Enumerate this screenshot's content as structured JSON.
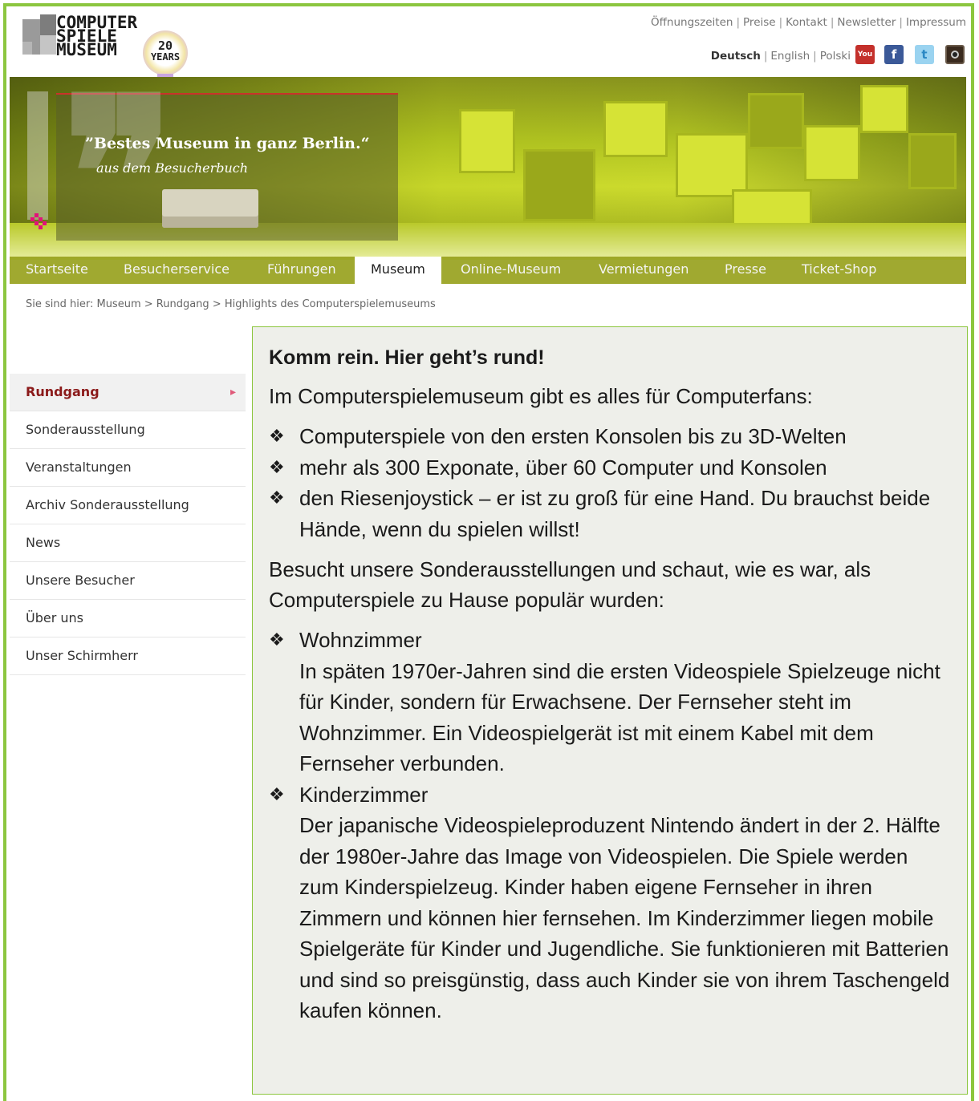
{
  "logo": {
    "line1": "COMPUTER",
    "line2": "SPIELE",
    "line3": "MUSEUM",
    "badge_number": "20",
    "badge_text": "YEARS"
  },
  "toplinks": [
    "Öffnungszeiten",
    "Preise",
    "Kontakt",
    "Newsletter",
    "Impressum"
  ],
  "languages": {
    "active": "Deutsch",
    "others": [
      "English",
      "Polski"
    ]
  },
  "social": {
    "youtube_label": "You",
    "facebook_label": "f",
    "twitter_label": "t"
  },
  "hero": {
    "quote": "”Bestes Museum in ganz Berlin.“",
    "source": "aus dem Besucherbuch"
  },
  "nav": [
    "Startseite",
    "Besucherservice",
    "Führungen",
    "Museum",
    "Online-Museum",
    "Vermietungen",
    "Presse",
    "Ticket-Shop"
  ],
  "breadcrumb": "Sie sind hier: Museum > Rundgang > Highlights des Computerspielemuseums",
  "sidebar": {
    "active": "Rundgang",
    "items": [
      "Sonderausstellung",
      "Veranstaltungen",
      "Archiv Sonderausstellung",
      "News",
      "Unsere Besucher",
      "Über uns",
      "Unser Schirmherr"
    ]
  },
  "content": {
    "title": "Komm rein. Hier geht’s rund!",
    "intro": "Im Computerspielemuseum gibt es alles für Computerfans:",
    "bullet_symbol": "❖",
    "list1": [
      "Computerspiele von den ersten Konsolen bis zu 3D-Welten",
      "mehr als 300 Exponate, über 60 Computer und Konsolen",
      "den Riesenjoystick – er ist zu groß für eine Hand. Du brauchst beide Hände, wenn du spielen willst!"
    ],
    "para2": "Besucht unsere Sonderausstellungen und schaut, wie es war, als Computerspiele zu Hause populär wurden:",
    "list2": [
      {
        "title": "Wohnzimmer",
        "text": "In späten 1970er-Jahren sind die ersten Videospiele Spielzeuge nicht für Kinder, sondern für Erwachsene. Der Fernseher steht im Wohnzimmer. Ein Videospielgerät ist mit einem Kabel mit dem Fernseher verbunden."
      },
      {
        "title": "Kinderzimmer",
        "text": "Der japanische Videospieleproduzent Nintendo ändert in der 2. Hälfte der 1980er-Jahre das Image von Videospielen. Die Spiele werden zum Kinderspielzeug. Kinder haben eigene Fernseher in ihren Zimmern und können hier fernsehen. Im Kinderzimmer liegen mobile Spielgeräte für Kinder und Jugendliche. Sie funktionieren mit Batterien und sind so preisgünstig, dass auch Kinder sie von ihrem Taschengeld kaufen können."
      }
    ]
  },
  "colors": {
    "frame": "#8cc63f",
    "accent": "#8b1a1a",
    "nav_bg": "#96a019"
  }
}
